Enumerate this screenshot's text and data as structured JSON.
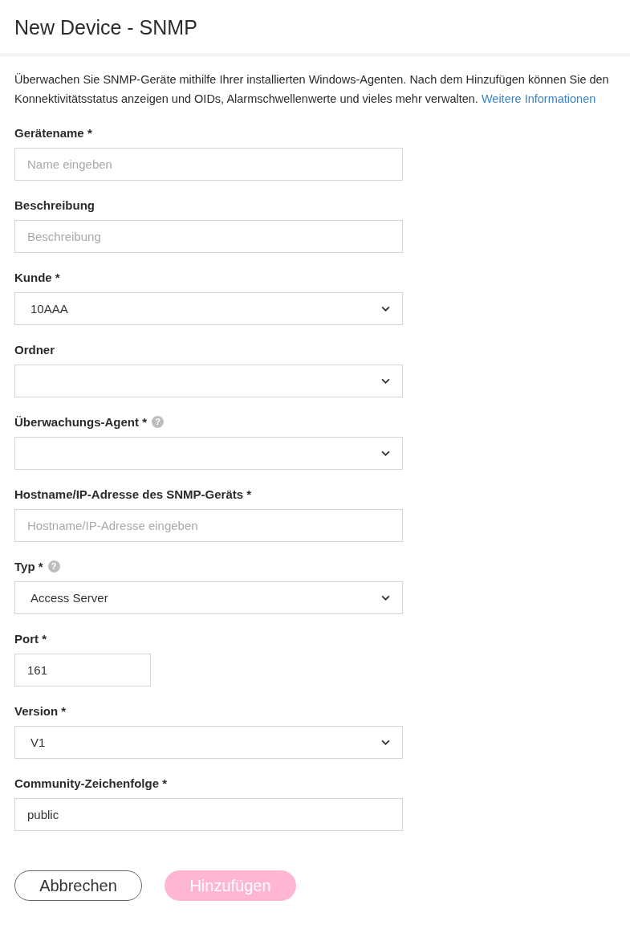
{
  "title": "New Device - SNMP",
  "intro": {
    "text": "Überwachen Sie SNMP-Geräte mithilfe Ihrer installierten Windows-Agenten. Nach dem Hinzufügen können Sie den Konnektivitätsstatus anzeigen und OIDs, Alarmschwellenwerte und vieles mehr verwalten.",
    "link": "Weitere Informationen"
  },
  "fields": [
    {
      "kind": "text",
      "label": "Gerätename *",
      "placeholder": "Name eingeben"
    },
    {
      "kind": "text",
      "label": "Beschreibung",
      "placeholder": "Beschreibung"
    },
    {
      "kind": "select",
      "label": "Kunde *",
      "value": "10AAA"
    },
    {
      "kind": "select",
      "label": "Ordner"
    },
    {
      "kind": "select",
      "label": "Überwachungs-Agent *",
      "help": "?"
    },
    {
      "kind": "text",
      "label": "Hostname/IP-Adresse des SNMP-Geräts *",
      "placeholder": "Hostname/IP-Adresse eingeben"
    },
    {
      "kind": "select",
      "label": "Typ *",
      "help": "?",
      "value": "Access Server"
    },
    {
      "kind": "short",
      "label": "Port *",
      "value": "161"
    },
    {
      "kind": "select",
      "label": "Version *",
      "value": "V1"
    },
    {
      "kind": "text",
      "label": "Community-Zeichenfolge *",
      "value": "public"
    }
  ],
  "buttons": [
    {
      "kind": "cancel",
      "label": "Abbrechen",
      "disabled": false
    },
    {
      "kind": "primary",
      "label": "Hinzufügen",
      "disabled": true
    }
  ]
}
